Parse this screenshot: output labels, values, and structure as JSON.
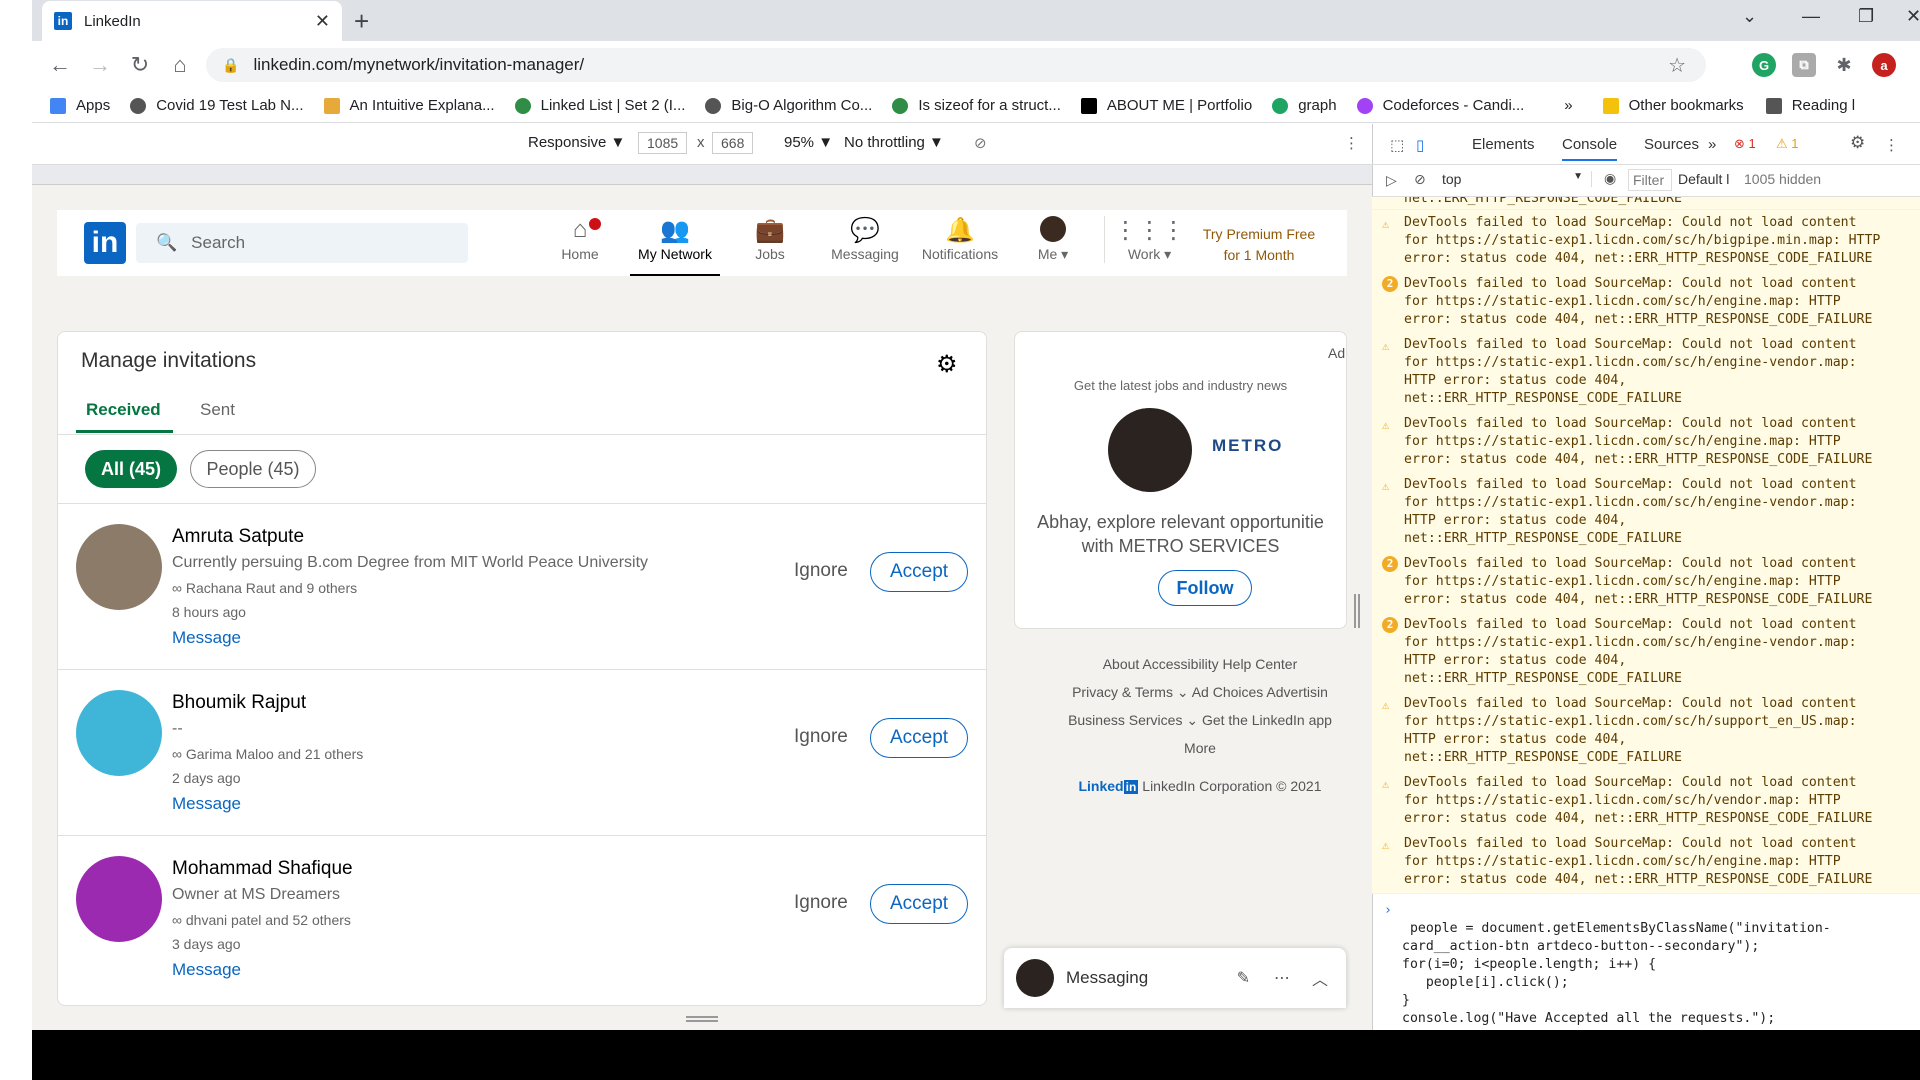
{
  "browser": {
    "tab_title": "LinkedIn",
    "url": "linkedin.com/mynetwork/invitation-manager/",
    "bookmarks": [
      "Apps",
      "Covid 19 Test Lab N...",
      "An Intuitive Explana...",
      "Linked List | Set 2 (I...",
      "Big-O Algorithm Co...",
      "Is sizeof for a struct...",
      "ABOUT ME | Portfolio",
      "graph",
      "Codeforces - Candi...",
      "»",
      "Other bookmarks",
      "Reading l"
    ]
  },
  "device_toolbar": {
    "mode": "Responsive ▼",
    "width": "1085",
    "x": "x",
    "height": "668",
    "zoom": "95% ▼",
    "throttle": "No throttling ▼"
  },
  "linkedin": {
    "search_placeholder": "Search",
    "nav": [
      {
        "label": "Home",
        "icon": "home-icon"
      },
      {
        "label": "My Network",
        "icon": "network-icon"
      },
      {
        "label": "Jobs",
        "icon": "briefcase-icon"
      },
      {
        "label": "Messaging",
        "icon": "chat-icon"
      },
      {
        "label": "Notifications",
        "icon": "bell-icon"
      },
      {
        "label": "Me ▾",
        "icon": "avatar"
      },
      {
        "label": "Work ▾",
        "icon": "grid-icon"
      }
    ],
    "premium": [
      "Try Premium Free",
      "for 1 Month"
    ],
    "invitations": {
      "title": "Manage invitations",
      "tab_received": "Received",
      "tab_sent": "Sent",
      "filter_all": "All (45)",
      "filter_people": "People (45)",
      "people": [
        {
          "name": "Amruta Satpute",
          "headline": "Currently persuing B.com Degree from MIT World Peace University",
          "mutual": "Rachana Raut and 9 others",
          "time": "8 hours ago",
          "message": "Message",
          "ignore": "Ignore",
          "accept": "Accept"
        },
        {
          "name": "Bhoumik Rajput",
          "headline": "--",
          "mutual": "Garima Maloo and 21 others",
          "time": "2 days ago",
          "message": "Message",
          "ignore": "Ignore",
          "accept": "Accept"
        },
        {
          "name": "Mohammad Shafique",
          "headline": "Owner at MS Dreamers",
          "mutual": "dhvani patel and 52 others",
          "time": "3 days ago",
          "message": "Message",
          "ignore": "Ignore",
          "accept": "Accept"
        }
      ]
    },
    "ad": {
      "label": "Ad",
      "tagline": "Get the latest jobs and industry news",
      "brand": "METRO",
      "text1": "Abhay, explore relevant opportunitie",
      "text2": "with METRO SERVICES",
      "follow": "Follow"
    },
    "footer": {
      "row1": "About    Accessibility    Help Center",
      "row2": "Privacy & Terms ⌄    Ad Choices    Advertisin",
      "row3": "Business Services ⌄    Get the LinkedIn app",
      "row4": "More",
      "copyright": "LinkedIn Corporation © 2021",
      "brand": "Linked"
    },
    "messaging": "Messaging"
  },
  "devtools": {
    "tabs": [
      "Elements",
      "Console",
      "Sources",
      "»"
    ],
    "errors": "1",
    "warnings": "1",
    "context": "top",
    "filter": "Filter",
    "levels": "Default l",
    "hidden": "1005 hidden",
    "top_fragment": "net::ERR_HTTP_RESPONSE_CODE_FAILURE",
    "messages": [
      {
        "count": "",
        "text": "DevTools failed to load SourceMap: Could not load content\nfor https://static-exp1.licdn.com/sc/h/bigpipe.min.map: HTTP\nerror: status code 404, net::ERR_HTTP_RESPONSE_CODE_FAILURE"
      },
      {
        "count": "2",
        "text": "DevTools failed to load SourceMap: Could not load content\nfor https://static-exp1.licdn.com/sc/h/engine.map: HTTP\nerror: status code 404, net::ERR_HTTP_RESPONSE_CODE_FAILURE"
      },
      {
        "count": "",
        "text": "DevTools failed to load SourceMap: Could not load content\nfor https://static-exp1.licdn.com/sc/h/engine-vendor.map:\nHTTP error: status code 404,\nnet::ERR_HTTP_RESPONSE_CODE_FAILURE"
      },
      {
        "count": "",
        "text": "DevTools failed to load SourceMap: Could not load content\nfor https://static-exp1.licdn.com/sc/h/engine.map: HTTP\nerror: status code 404, net::ERR_HTTP_RESPONSE_CODE_FAILURE"
      },
      {
        "count": "",
        "text": "DevTools failed to load SourceMap: Could not load content\nfor https://static-exp1.licdn.com/sc/h/engine-vendor.map:\nHTTP error: status code 404,\nnet::ERR_HTTP_RESPONSE_CODE_FAILURE"
      },
      {
        "count": "2",
        "text": "DevTools failed to load SourceMap: Could not load content\nfor https://static-exp1.licdn.com/sc/h/engine.map: HTTP\nerror: status code 404, net::ERR_HTTP_RESPONSE_CODE_FAILURE"
      },
      {
        "count": "2",
        "text": "DevTools failed to load SourceMap: Could not load content\nfor https://static-exp1.licdn.com/sc/h/engine-vendor.map:\nHTTP error: status code 404,\nnet::ERR_HTTP_RESPONSE_CODE_FAILURE"
      },
      {
        "count": "",
        "text": "DevTools failed to load SourceMap: Could not load content\nfor https://static-exp1.licdn.com/sc/h/support_en_US.map:\nHTTP error: status code 404,\nnet::ERR_HTTP_RESPONSE_CODE_FAILURE"
      },
      {
        "count": "",
        "text": "DevTools failed to load SourceMap: Could not load content\nfor https://static-exp1.licdn.com/sc/h/vendor.map: HTTP\nerror: status code 404, net::ERR_HTTP_RESPONSE_CODE_FAILURE"
      },
      {
        "count": "",
        "text": "DevTools failed to load SourceMap: Could not load content\nfor https://static-exp1.licdn.com/sc/h/engine.map: HTTP\nerror: status code 404, net::ERR_HTTP_RESPONSE_CODE_FAILURE"
      }
    ],
    "input": "people = document.getElementsByClassName(\"invitation-\ncard__action-btn artdeco-button--secondary\");\nfor(i=0; i<people.length; i++) {\n   people[i].click();\n}\nconsole.log(\"Have Accepted all the requests.\");"
  },
  "colors": {
    "linkedin_blue": "#0a66c2",
    "green": "#057642",
    "warn_bg": "#fffbe5"
  }
}
